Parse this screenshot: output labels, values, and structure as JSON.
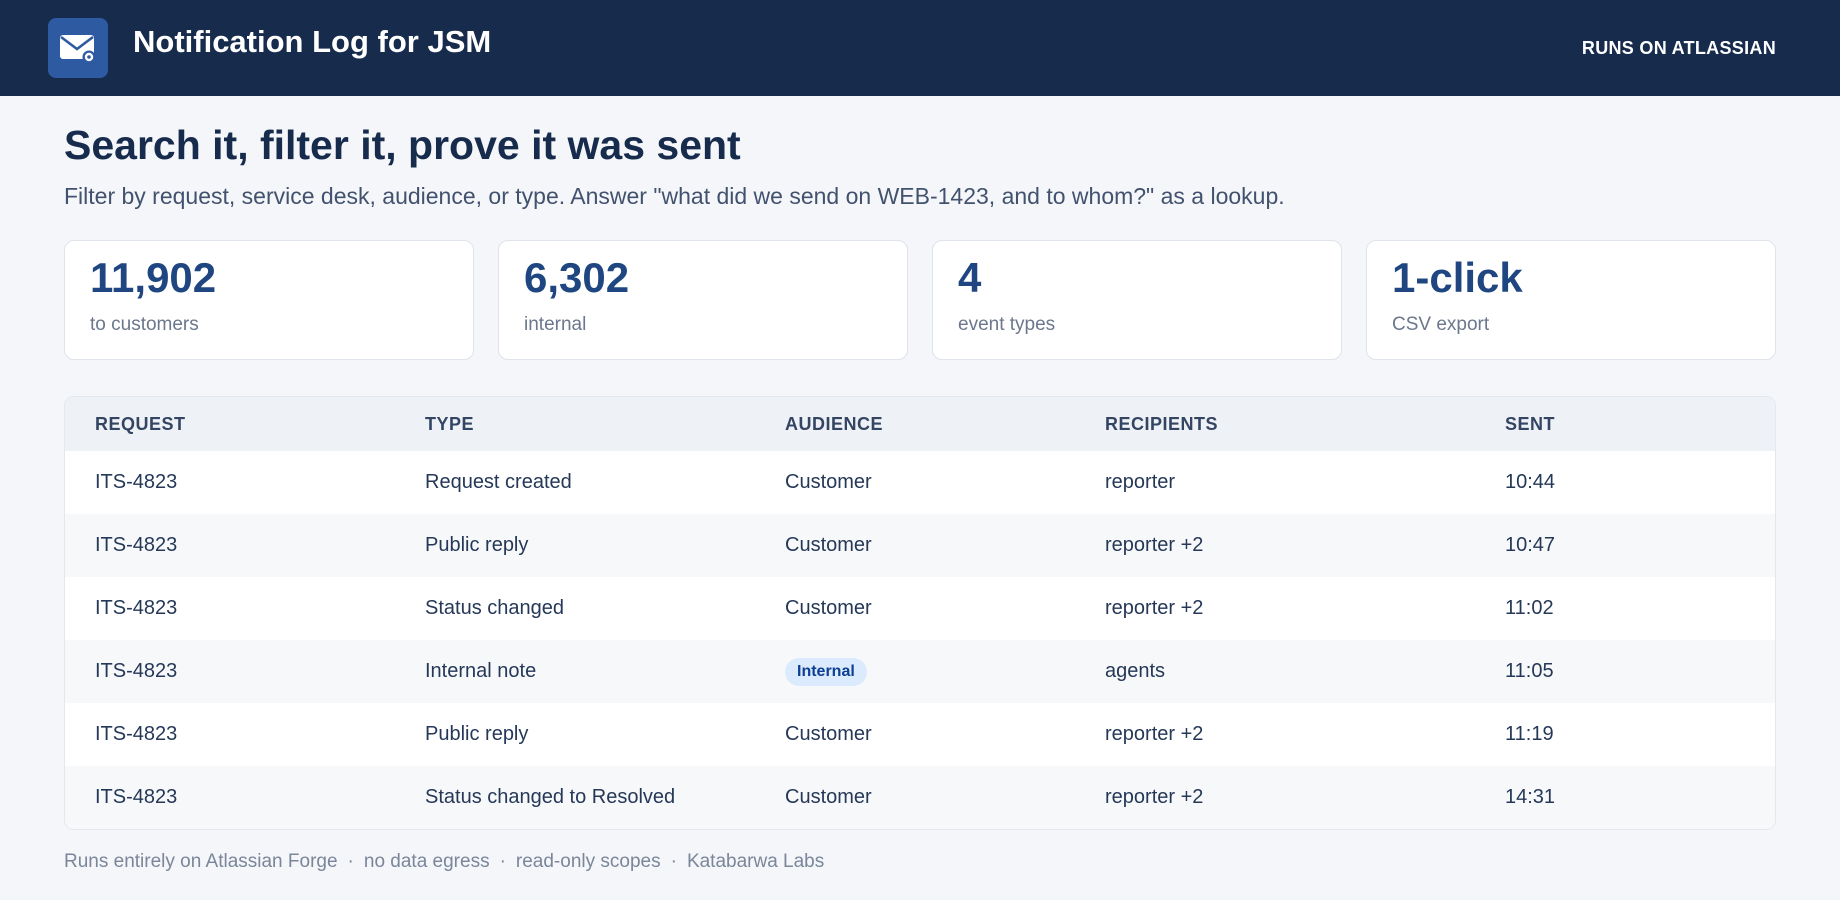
{
  "header": {
    "app_title": "Notification Log for JSM",
    "badge": "RUNS ON ATLASSIAN",
    "logo_icon": "mail-gear-icon"
  },
  "hero": {
    "headline": "Search it, filter it, prove it was sent",
    "subline": "Filter by request, service desk, audience, or type. Answer \"what did we send on WEB-1423, and to whom?\" as a lookup."
  },
  "stats": [
    {
      "value": "11,902",
      "label": "to customers"
    },
    {
      "value": "6,302",
      "label": "internal"
    },
    {
      "value": "4",
      "label": "event types"
    },
    {
      "value": "1-click",
      "label": "CSV export"
    }
  ],
  "table": {
    "columns": [
      "REQUEST",
      "TYPE",
      "AUDIENCE",
      "RECIPIENTS",
      "SENT"
    ],
    "rows": [
      {
        "request": "ITS-4823",
        "type": "Request created",
        "audience": "Customer",
        "recipients": "reporter",
        "sent": "10:44"
      },
      {
        "request": "ITS-4823",
        "type": "Public reply",
        "audience": "Customer",
        "recipients": "reporter +2",
        "sent": "10:47"
      },
      {
        "request": "ITS-4823",
        "type": "Status changed",
        "audience": "Customer",
        "recipients": "reporter +2",
        "sent": "11:02"
      },
      {
        "request": "ITS-4823",
        "type": "Internal note",
        "audience": "Internal",
        "recipients": "agents",
        "sent": "11:05"
      },
      {
        "request": "ITS-4823",
        "type": "Public reply",
        "audience": "Customer",
        "recipients": "reporter +2",
        "sent": "11:19"
      },
      {
        "request": "ITS-4823",
        "type": "Status changed to Resolved",
        "audience": "Customer",
        "recipients": "reporter +2",
        "sent": "14:31"
      }
    ]
  },
  "footer": {
    "items": [
      "Runs entirely on Atlassian Forge",
      "no data egress",
      "read-only scopes",
      "Katabarwa Labs"
    ],
    "separator": "·"
  },
  "colors": {
    "topbar": "#172b4d",
    "accent": "#1f4680",
    "internal_pill_bg": "#dceafe",
    "internal_pill_text": "#0b3f91"
  }
}
